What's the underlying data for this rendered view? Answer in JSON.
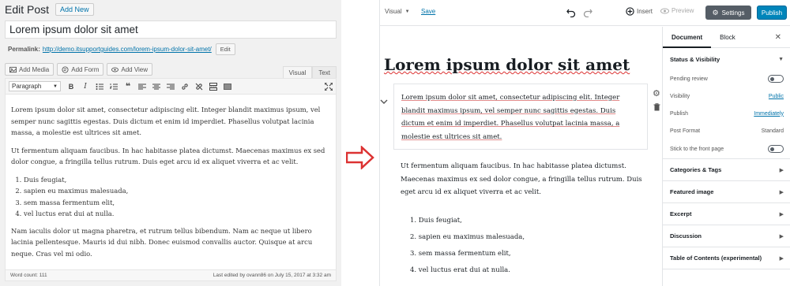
{
  "classic": {
    "title": "Edit Post",
    "add_new": "Add New",
    "post_title": "Lorem ipsum dolor sit amet",
    "permalink_label": "Permalink:",
    "permalink_url": "http://demo.itsupportguides.com/lorem-ipsum-dolor-sit-amet/",
    "edit_label": "Edit",
    "media_buttons": [
      "Add Media",
      "Add Form",
      "Add View"
    ],
    "tabs": [
      "Visual",
      "Text"
    ],
    "format_select": "Paragraph",
    "paragraphs": [
      "Lorem ipsum dolor sit amet, consectetur adipiscing elit. Integer blandit maximus ipsum, vel semper nunc sagittis egestas. Duis dictum et enim id imperdiet. Phasellus volutpat lacinia massa, a molestie est ultrices sit amet.",
      "Ut fermentum aliquam faucibus. In hac habitasse platea dictumst. Maecenas maximus ex sed dolor congue, a fringilla tellus rutrum. Duis eget arcu id ex aliquet viverra et ac velit.",
      "Nam iaculis dolor ut magna pharetra, et rutrum tellus bibendum. Nam ac neque ut libero lacinia pellentesque. Mauris id dui nibh. Donec euismod convallis auctor. Quisque at arcu neque. Cras vel mi odio."
    ],
    "list_items": [
      "Duis feugiat,",
      "sapien eu maximus malesuada,",
      "sem massa fermentum elit,",
      "vel luctus erat dui at nulla."
    ],
    "word_count": "Word count: 111",
    "last_edited": "Last edited by ovann86 on July 15, 2017 at 3:32 am"
  },
  "gutenberg": {
    "mode": "Visual",
    "save": "Save",
    "insert": "Insert",
    "preview": "Preview",
    "settings": "Settings",
    "publish": "Publish",
    "post_title": "Lorem ipsum dolor sit amet",
    "para1": "Lorem ipsum dolor sit amet, consectetur adipiscing elit. Integer blandit maximus ipsum, vel semper nunc sagittis egestas. Duis dictum et enim id imperdiet. Phasellus volutpat lacinia massa, a molestie est ultrices sit amet.",
    "para2": "Ut fermentum aliquam faucibus. In hac habitasse platea dictumst. Maecenas maximus ex sed dolor congue, a fringilla tellus rutrum. Duis eget arcu id ex aliquet viverra et ac velit.",
    "list_items": [
      "1. Duis feugiat,",
      "2. sapien eu maximus malesuada,",
      "3. sem massa fermentum elit,",
      "4. vel luctus erat dui at nulla."
    ],
    "sidebar": {
      "tab_document": "Document",
      "tab_block": "Block",
      "status_visibility": "Status & Visibility",
      "pending_review": "Pending review",
      "visibility": "Visibility",
      "visibility_value": "Public",
      "publish": "Publish",
      "publish_value": "Immediately",
      "post_format": "Post Format",
      "post_format_value": "Standard",
      "stick": "Stick to the front page",
      "panels": [
        "Categories & Tags",
        "Featured image",
        "Excerpt",
        "Discussion",
        "Table of Contents (experimental)"
      ]
    }
  },
  "colors": {
    "accent": "#0073aa",
    "publish": "#0085ba",
    "arrow": "#dc3232"
  }
}
